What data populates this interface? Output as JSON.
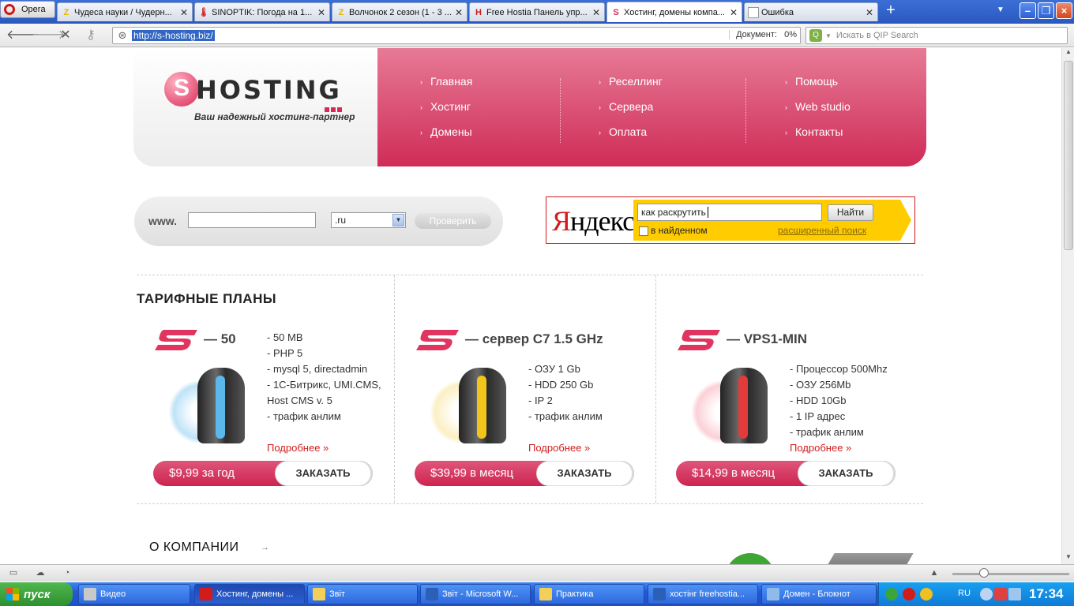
{
  "browser": {
    "menu_label": "Opera",
    "tabs": [
      {
        "title": "Чудеса науки / Чудерн...",
        "favicon": "Z",
        "favicon_color": "#e8b400"
      },
      {
        "title": "SINOPTIK: Погода на 1...",
        "favicon": "🌡",
        "favicon_color": "#d21c1c"
      },
      {
        "title": "Волчонок 2 сезон (1 - 3 ...",
        "favicon": "Z",
        "favicon_color": "#e8b400"
      },
      {
        "title": "Free Hostia Панель упр...",
        "favicon": "H",
        "favicon_color": "#c81c1c"
      },
      {
        "title": "Хостинг, домены компа...",
        "favicon": "S",
        "favicon_color": "#d92a57",
        "active": true
      },
      {
        "title": "Ошибка",
        "favicon": "",
        "favicon_color": "#ffffff"
      }
    ],
    "url": "http://s-hosting.biz/",
    "doc_status_label": "Документ:",
    "doc_status_value": "0%",
    "search_placeholder": "Искать в QIP Search"
  },
  "header": {
    "logo_word": "HOSTING",
    "logo_letter": "S",
    "slogan": "Ваш надежный хостинг-партнер",
    "menu_columns": [
      [
        "Главная",
        "Хостинг",
        "Домены"
      ],
      [
        "Реселлинг",
        "Сервера",
        "Оплата"
      ],
      [
        "Помощь",
        "Web studio",
        "Контакты"
      ]
    ]
  },
  "domain_check": {
    "prefix": "www.",
    "input_value": "",
    "zone": ".ru",
    "button": "Проверить"
  },
  "yandex": {
    "logo_first": "Я",
    "logo_rest": "ндекс",
    "query": "как раскрутить",
    "button": "Найти",
    "checkbox_label": "в найденном",
    "advanced_link": "расширенный поиск"
  },
  "tariffs": {
    "title": "ТАРИФНЫЕ ПЛАНЫ",
    "plans": [
      {
        "name": "— 50",
        "accent": "#5bb8ea",
        "glow": "#bfe3f7",
        "features": [
          "- 50 MB",
          "- PHP 5",
          "- mysql 5, directadmin",
          "- 1С-Битрикс, UMI.CMS,",
          "   Host CMS v. 5",
          "- трафик анлим"
        ],
        "more": "Подробнее »",
        "price": "$9,99 за год",
        "order": "ЗАКАЗАТЬ"
      },
      {
        "name": "— сервер C7 1.5 GHz",
        "accent": "#f1c51a",
        "glow": "#fbefc2",
        "features": [
          "- ОЗУ 1 Gb",
          "- HDD 250 Gb",
          "- IP 2",
          "- трафик анлим"
        ],
        "more": "Подробнее »",
        "price": "$39,99 в месяц",
        "order": "ЗАКАЗАТЬ"
      },
      {
        "name": "— VPS1-MIN",
        "accent": "#e23b3b",
        "glow": "#fbd0d6",
        "features": [
          "- Процессор 500Mhz",
          "- ОЗУ 256Mb",
          "- HDD 10Gb",
          "- 1 IP адрес",
          "- трафик анлим"
        ],
        "more": "Подробнее »",
        "price": "$14,99 в месяц",
        "order": "ЗАКАЗАТЬ"
      }
    ]
  },
  "about": {
    "title": "О КОМПАНИИ",
    "arrow": "→"
  },
  "taskbar": {
    "start": "пуск",
    "tasks": [
      {
        "label": "Видео",
        "icon_color": "#c9c9c9"
      },
      {
        "label": "Хостинг, домены ...",
        "icon_color": "#d21c1c",
        "active": true
      },
      {
        "label": "Звіт",
        "icon_color": "#f2cf58"
      },
      {
        "label": "Звіт - Microsoft W...",
        "icon_color": "#2b5fb8"
      },
      {
        "label": "Практика",
        "icon_color": "#f2cf58"
      },
      {
        "label": "хостінг freehostia...",
        "icon_color": "#2b5fb8"
      },
      {
        "label": "Домен - Блокнот",
        "icon_color": "#8fbbe8"
      }
    ],
    "lang": "RU",
    "clock": "17:34"
  }
}
